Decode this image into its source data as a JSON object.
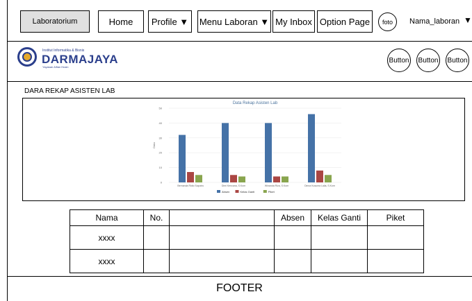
{
  "nav": {
    "laboratorium": "Laboratorium",
    "home": "Home",
    "profile": "Profile ▼",
    "menu_laboran": "Menu Laboran ▼",
    "my_inbox": "My Inbox",
    "option_page": "Option Page",
    "foto": "foto",
    "username": "Nama_laboran",
    "caret": "▼"
  },
  "brand": {
    "institute": "Institut Informatika & Bisnis",
    "name": "DARMAJAYA",
    "yayasan": "Yayasan Alfian Husin"
  },
  "right_buttons": [
    "Button",
    "Button",
    "Button"
  ],
  "section_title": "DARA REKAP ASISTEN LAB",
  "chart_data": {
    "type": "bar",
    "title": "Data Rekap Asisten Lab",
    "ylabel": "Data",
    "ylim": [
      0,
      50
    ],
    "yticks": [
      0,
      10,
      20,
      30,
      40,
      50
    ],
    "categories": [
      "Bernanda Ridio Saputra",
      "Dimi Kencana, S.Kom",
      "Winanda Riza, S.Kom",
      "Dinna Kusuma Laila, S.Kom"
    ],
    "series": [
      {
        "name": "Absen",
        "color": "#4572a7",
        "values": [
          32,
          40,
          40,
          46
        ]
      },
      {
        "name": "Kelas Ganti",
        "color": "#aa4643",
        "values": [
          7,
          5,
          4,
          8
        ]
      },
      {
        "name": "Piket",
        "color": "#89a54e",
        "values": [
          5,
          4,
          4,
          5
        ]
      }
    ],
    "legend": "bottom-center",
    "grid": true
  },
  "table": {
    "headers": [
      "Nama",
      "No.",
      "",
      "Absen",
      "Kelas Ganti",
      "Piket"
    ],
    "rows": [
      [
        "xxxx",
        "",
        "",
        "",
        "",
        ""
      ],
      [
        "xxxx",
        "",
        "",
        "",
        "",
        ""
      ]
    ]
  },
  "footer": "FOOTER"
}
